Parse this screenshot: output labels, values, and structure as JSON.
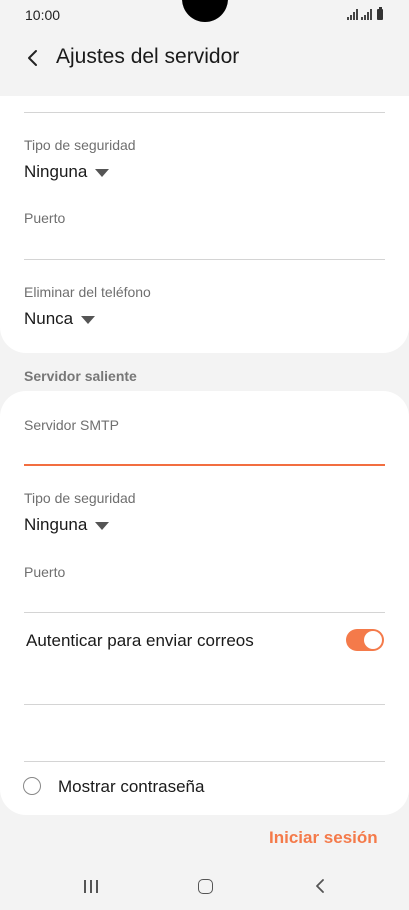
{
  "status_bar": {
    "time": "10:00"
  },
  "app_bar": {
    "title": "Ajustes del servidor"
  },
  "incoming": {
    "security_type_label": "Tipo de seguridad",
    "security_type_value": "Ninguna",
    "port_label": "Puerto",
    "port_value": "",
    "delete_from_phone_label": "Eliminar del teléfono",
    "delete_from_phone_value": "Nunca"
  },
  "outgoing": {
    "section_title": "Servidor saliente",
    "smtp_server_label": "Servidor SMTP",
    "smtp_server_value": "",
    "security_type_label": "Tipo de seguridad",
    "security_type_value": "Ninguna",
    "port_label": "Puerto",
    "port_value": "",
    "auth_label": "Autenticar para enviar correos",
    "auth_enabled": true,
    "username_value": "",
    "password_value": "",
    "show_password_label": "Mostrar contraseña",
    "show_password_checked": false
  },
  "footer": {
    "signin_label": "Iniciar sesión"
  },
  "colors": {
    "accent": "#f47a4a",
    "card_background": "#ffffff",
    "page_background": "#f3f3f3"
  }
}
